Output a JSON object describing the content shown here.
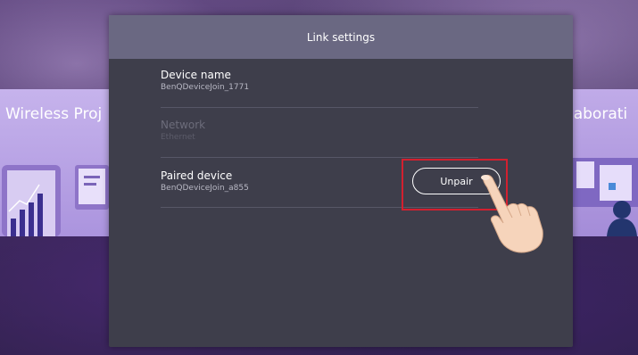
{
  "background": {
    "left_card_title": "Wireless Proj",
    "right_card_title": "laborati"
  },
  "dialog": {
    "title": "Link settings",
    "rows": [
      {
        "label": "Device name",
        "value": "BenQDeviceJoin_1771",
        "enabled": true
      },
      {
        "label": "Network",
        "value": "Ethernet",
        "enabled": false
      },
      {
        "label": "Paired device",
        "value": "BenQDeviceJoin_a855",
        "enabled": true
      }
    ],
    "unpair_label": "Unpair"
  },
  "colors": {
    "dialog_bg": "#3e3e4b",
    "header_bg": "#6a6882",
    "highlight": "#d3202f"
  },
  "icons": [
    "tap-hand-icon",
    "phone-chart-icon",
    "monitor-icon",
    "person-icon"
  ]
}
